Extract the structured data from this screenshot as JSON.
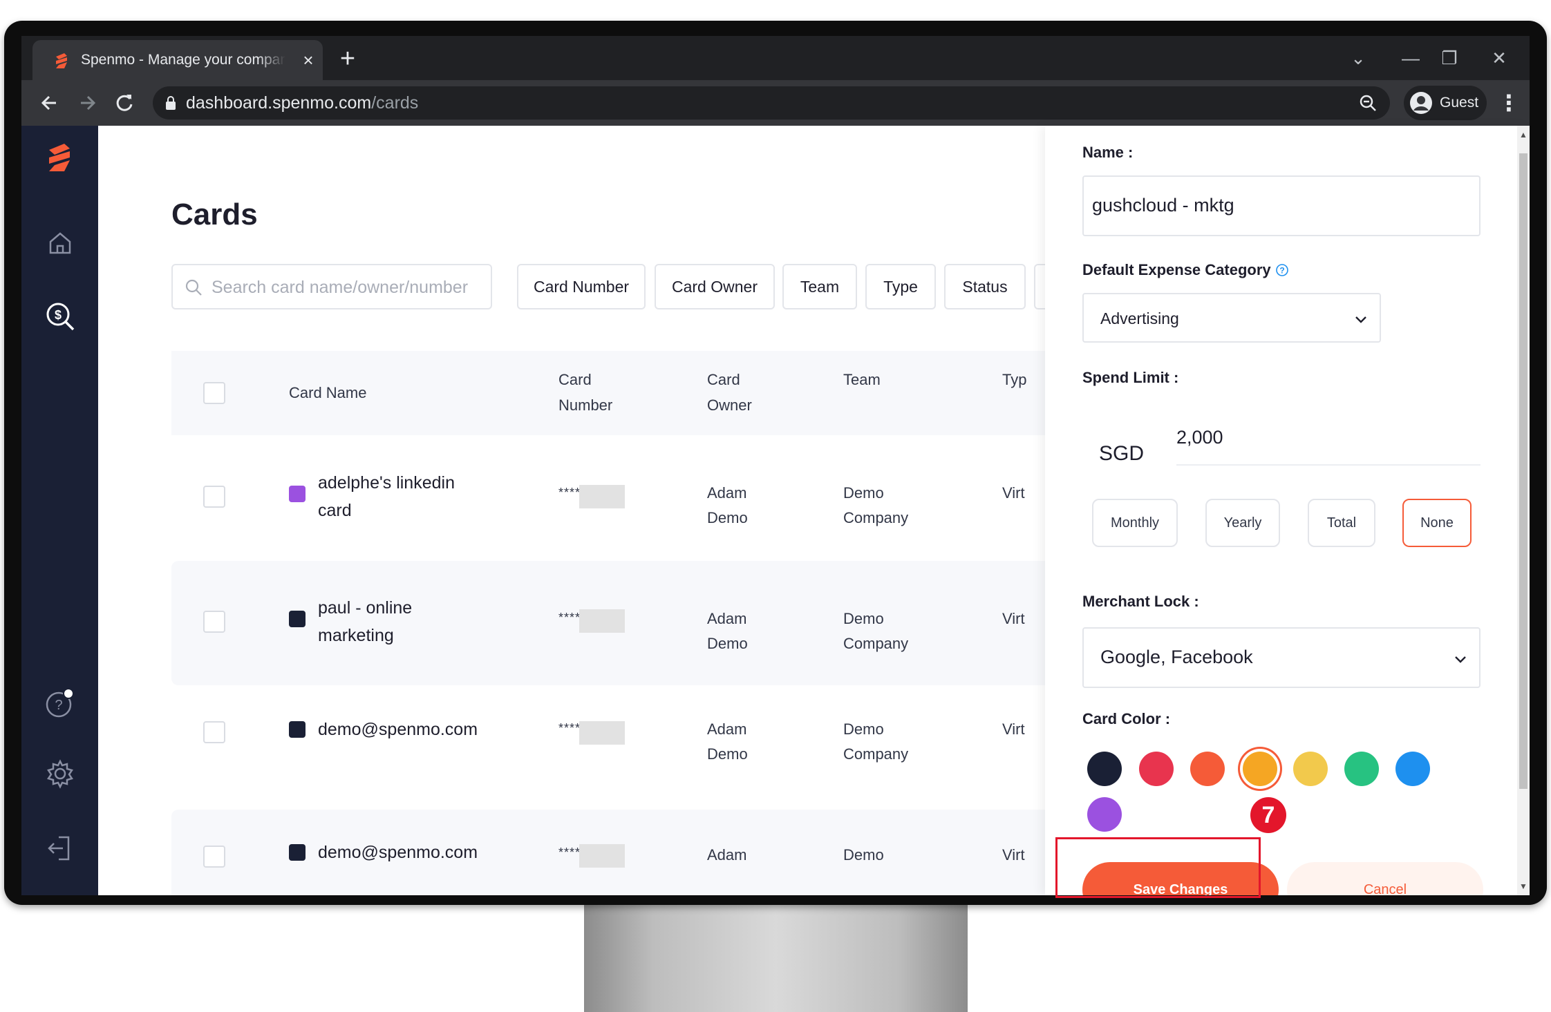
{
  "browser": {
    "tab_title": "Spenmo - Manage your company expenses",
    "tab_close": "×",
    "new_tab": "+",
    "url_host": "dashboard.spenmo.com",
    "url_path": "/cards",
    "profile_label": "Guest",
    "window_controls": [
      "⌄",
      "—",
      "❐",
      "✕"
    ]
  },
  "page": {
    "title": "Cards",
    "search_placeholder": "Search card name/owner/number",
    "filters": [
      "Card Number",
      "Card Owner",
      "Team",
      "Type",
      "Status"
    ]
  },
  "table": {
    "headers": {
      "card_name": "Card Name",
      "card_number": [
        "Card",
        "Number"
      ],
      "card_owner": [
        "Card",
        "Owner"
      ],
      "team": "Team",
      "type": "Typ"
    },
    "rows": [
      {
        "name": [
          "adelphe's linkedin",
          "card"
        ],
        "color": "#9b51e0",
        "number": "****",
        "owner": [
          "Adam",
          "Demo"
        ],
        "team": [
          "Demo",
          "Company"
        ],
        "type": "Virt"
      },
      {
        "name": [
          "paul - online",
          "marketing"
        ],
        "color": "#1a2035",
        "number": "****",
        "owner": [
          "Adam",
          "Demo"
        ],
        "team": [
          "Demo",
          "Company"
        ],
        "type": "Virt"
      },
      {
        "name": [
          "demo@spenmo.com"
        ],
        "color": "#1a2035",
        "number": "****",
        "owner": [
          "Adam",
          "Demo"
        ],
        "team": [
          "Demo",
          "Company"
        ],
        "type": "Virt"
      },
      {
        "name": [
          "demo@spenmo.com"
        ],
        "color": "#1a2035",
        "number": "****",
        "owner": [
          "Adam",
          ""
        ],
        "team": [
          "Demo",
          ""
        ],
        "type": "Virt"
      }
    ]
  },
  "panel": {
    "name_label": "Name :",
    "name_value": "gushcloud - mktg",
    "expense_label": "Default Expense Category",
    "expense_value": "Advertising",
    "spend_label": "Spend Limit :",
    "currency": "SGD",
    "amount": "2,000",
    "periods": [
      "Monthly",
      "Yearly",
      "Total",
      "None"
    ],
    "active_period": "None",
    "merchant_label": "Merchant Lock :",
    "merchant_value": "Google, Facebook",
    "color_label": "Card Color :",
    "colors": [
      "#1a2035",
      "#e8344e",
      "#f55b38",
      "#f5a623",
      "#f2c94c",
      "#27c281",
      "#1e90ef",
      "#9b51e0"
    ],
    "selected_color": "#f5a623",
    "save_label": "Save Changes",
    "cancel_label": "Cancel"
  },
  "annotation": {
    "step": "7"
  },
  "theme": {
    "accent": "#f55b38",
    "sidebar": "#1a2035",
    "annotation_red": "#e3162b"
  }
}
